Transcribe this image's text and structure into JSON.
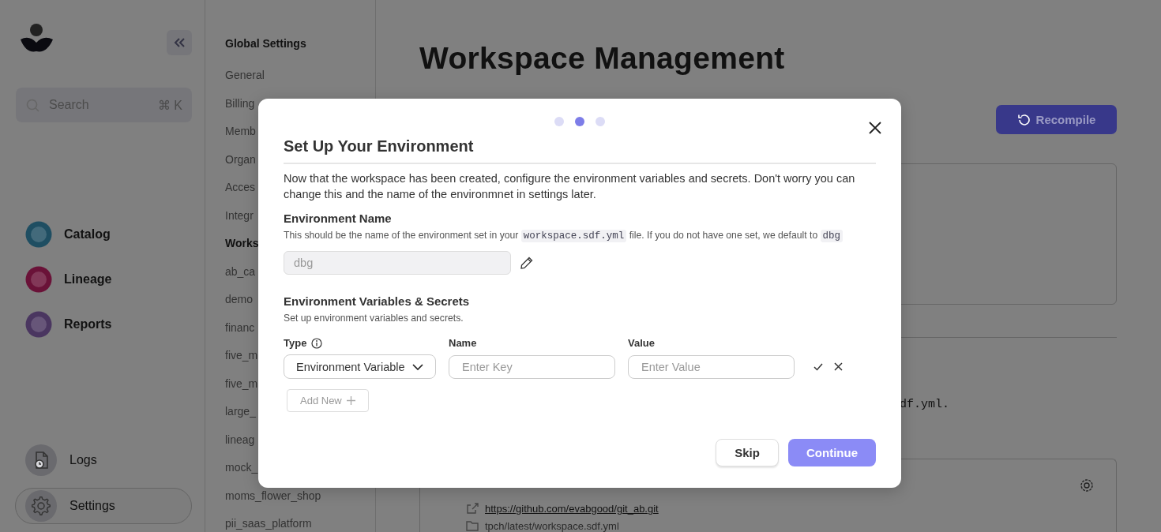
{
  "sidebar": {
    "search": {
      "placeholder": "Search",
      "shortcut": "⌘ K"
    },
    "nav": [
      {
        "label": "Catalog",
        "color": "#1f4e62"
      },
      {
        "label": "Lineage",
        "color": "#6a1238"
      },
      {
        "label": "Reports",
        "color": "#4a3660"
      }
    ],
    "bottom": [
      {
        "label": "Logs",
        "kind": "logs",
        "selected": false
      },
      {
        "label": "Settings",
        "kind": "settings",
        "selected": true
      }
    ]
  },
  "settings_nav": {
    "heading": "Global Settings",
    "items": [
      {
        "label": "General",
        "selected": false
      },
      {
        "label": "Billing",
        "selected": false
      },
      {
        "label": "Memb",
        "selected": false
      },
      {
        "label": "Organ",
        "selected": false
      },
      {
        "label": "Acces",
        "selected": false
      },
      {
        "label": "Integr",
        "selected": false
      },
      {
        "label": "Works",
        "selected": true
      },
      {
        "label": "ab_ca",
        "selected": false
      },
      {
        "label": "demo",
        "selected": false
      },
      {
        "label": "financ",
        "selected": false
      },
      {
        "label": "five_m",
        "selected": false
      },
      {
        "label": "five_m",
        "selected": false
      },
      {
        "label": "large_",
        "selected": false
      },
      {
        "label": "lineag",
        "selected": false
      },
      {
        "label": "mock_",
        "selected": false
      },
      {
        "label": "moms_flower_shop",
        "selected": false
      },
      {
        "label": "pii_saas_platform",
        "selected": false
      }
    ]
  },
  "main": {
    "title": "Workspace Management",
    "recompile": "Recompile",
    "file_text": "df.yml.",
    "link": "https://github.com/evabgood/git_ab.git",
    "path": "tpch/latest/workspace.sdf.yml"
  },
  "modal": {
    "steps": [
      {
        "selected": false
      },
      {
        "selected": true
      },
      {
        "selected": false
      }
    ],
    "title": "Set Up Your Environment",
    "description": "Now that the workspace has been created, configure the environment variables and secrets. Don't worry you can change this and the name of the environmnet in settings later.",
    "env_name": {
      "label": "Environment Name",
      "help": [
        {
          "kind": "text",
          "text": "This should be the name of the environment set in your "
        },
        {
          "kind": "code",
          "text": "workspace.sdf.yml"
        },
        {
          "kind": "text",
          "text": " file. If you do not have one set, we default to "
        },
        {
          "kind": "code",
          "text": "dbg"
        }
      ],
      "value": "dbg",
      "disabled": true
    },
    "variables": {
      "label": "Environment Variables & Secrets",
      "help": "Set up environment variables and secrets.",
      "columns": [
        {
          "label": "Type",
          "info": true
        },
        {
          "label": "Name",
          "info": false
        },
        {
          "label": "Value",
          "info": false
        }
      ],
      "row": {
        "type": "Environment Variable",
        "name_placeholder": "Enter Key",
        "value_placeholder": "Enter Value"
      },
      "add_new": "Add New"
    },
    "buttons": [
      {
        "label": "Skip",
        "kind": "secondary"
      },
      {
        "label": "Continue",
        "kind": "primary"
      }
    ]
  }
}
